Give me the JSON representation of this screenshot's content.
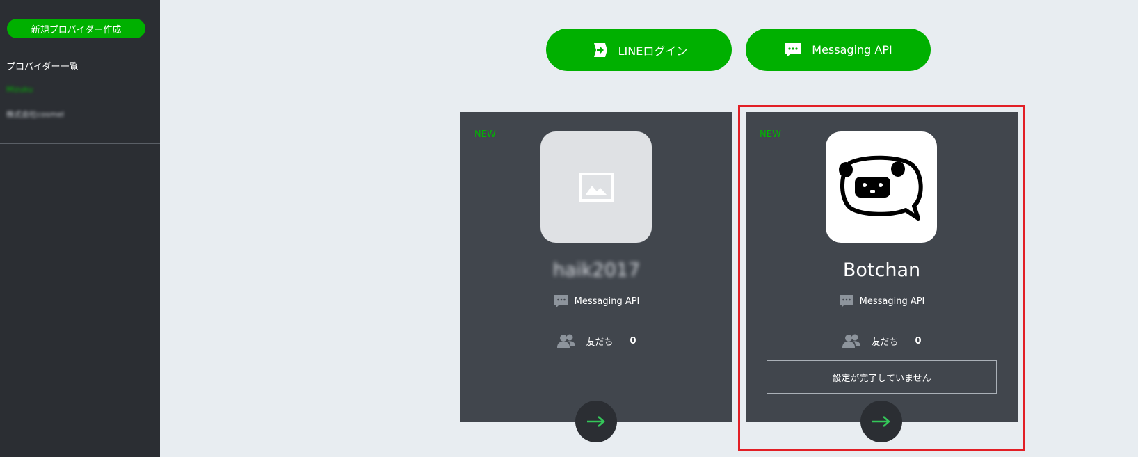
{
  "sidebar": {
    "new_provider_label": "新規プロバイダー作成",
    "provider_list_title": "プロバイダー一覧",
    "providers": [
      {
        "label": "Mizuku",
        "color": "#00b900"
      },
      {
        "label": "株式会社cosmel",
        "color": "#cfd3d8"
      }
    ]
  },
  "top_buttons": {
    "login_label": "LINEログイン",
    "messaging_label": "Messaging API"
  },
  "cards": [
    {
      "badge": "NEW",
      "name": "haik2017",
      "type_label": "Messaging API",
      "friends_label": "友だち",
      "friends_count": "0",
      "icon": "image-placeholder-icon"
    },
    {
      "badge": "NEW",
      "name": "Botchan",
      "type_label": "Messaging API",
      "friends_label": "友だち",
      "friends_count": "0",
      "status": "設定が完了していません",
      "icon": "botchan-panda-icon"
    }
  ],
  "colors": {
    "brand_green": "#00b000",
    "sidebar_bg": "#2b2e33",
    "card_bg": "#41464d",
    "highlight_red": "#e21f26",
    "arrow_green": "#34c759"
  }
}
